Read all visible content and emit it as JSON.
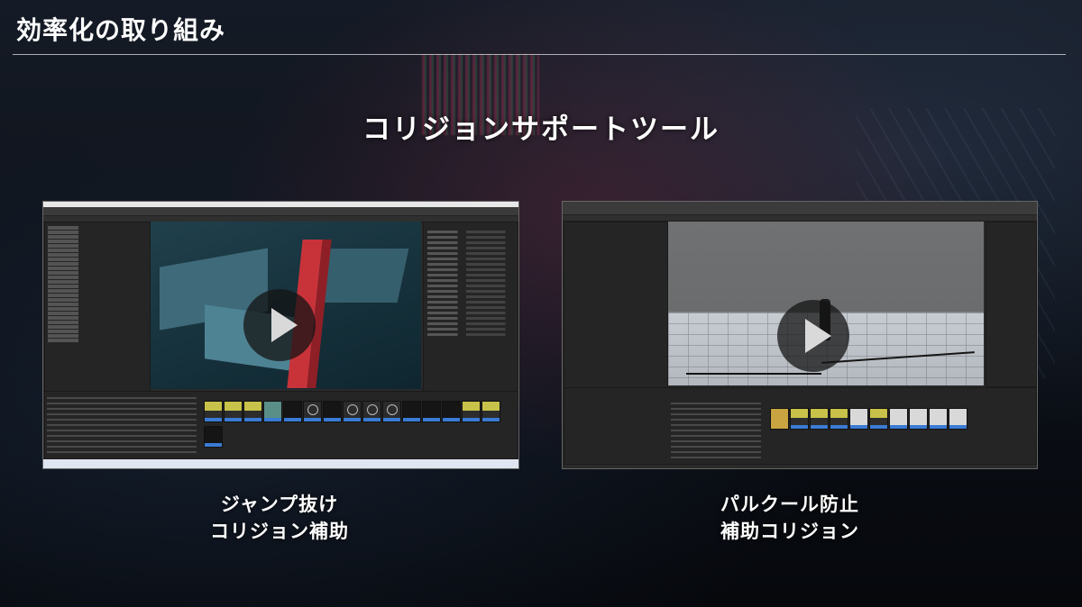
{
  "slide": {
    "title": "効率化の取り組み",
    "subtitle": "コリジョンサポートツール"
  },
  "videos": [
    {
      "caption_line1": "ジャンプ抜け",
      "caption_line2": "コリジョン補助",
      "play_icon": "play-icon"
    },
    {
      "caption_line1": "パルクール防止",
      "caption_line2": "補助コリジョン",
      "play_icon": "play-icon"
    }
  ],
  "colors": {
    "background": "#0b0e14",
    "text": "#ffffff",
    "editor_bg": "#2a2a2a",
    "viewport_sky_left": "#1d3a44",
    "red_wall": "#c8333a",
    "asset_label": "#3a7bd5"
  }
}
